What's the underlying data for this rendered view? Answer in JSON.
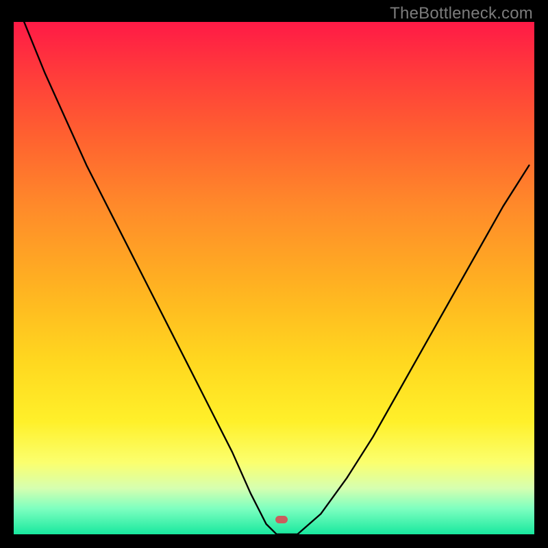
{
  "watermark": "TheBottleneck.com",
  "marker": {
    "x_frac": 0.515,
    "y_frac": 0.971,
    "color": "#c95d5d"
  },
  "chart_data": {
    "type": "line",
    "title": "",
    "xlabel": "",
    "ylabel": "",
    "xlim": [
      0,
      1
    ],
    "ylim": [
      0,
      1
    ],
    "legend": false,
    "grid": false,
    "background": "vertical-gradient red→orange→yellow→green",
    "annotations": [
      {
        "text": "TheBottleneck.com",
        "pos": "top-right"
      }
    ],
    "series": [
      {
        "name": "left-branch",
        "x": [
          0.02,
          0.06,
          0.1,
          0.14,
          0.18,
          0.22,
          0.26,
          0.3,
          0.34,
          0.38,
          0.42,
          0.455,
          0.485,
          0.505
        ],
        "y": [
          1.0,
          0.9,
          0.81,
          0.72,
          0.64,
          0.56,
          0.48,
          0.4,
          0.32,
          0.24,
          0.16,
          0.08,
          0.02,
          0.0
        ]
      },
      {
        "name": "valley-floor",
        "x": [
          0.505,
          0.545
        ],
        "y": [
          0.0,
          0.0
        ]
      },
      {
        "name": "right-branch",
        "x": [
          0.545,
          0.59,
          0.64,
          0.69,
          0.74,
          0.79,
          0.84,
          0.89,
          0.94,
          0.99
        ],
        "y": [
          0.0,
          0.04,
          0.11,
          0.19,
          0.28,
          0.37,
          0.46,
          0.55,
          0.64,
          0.72
        ]
      }
    ],
    "marker": {
      "x": 0.515,
      "y": 0.0
    }
  }
}
